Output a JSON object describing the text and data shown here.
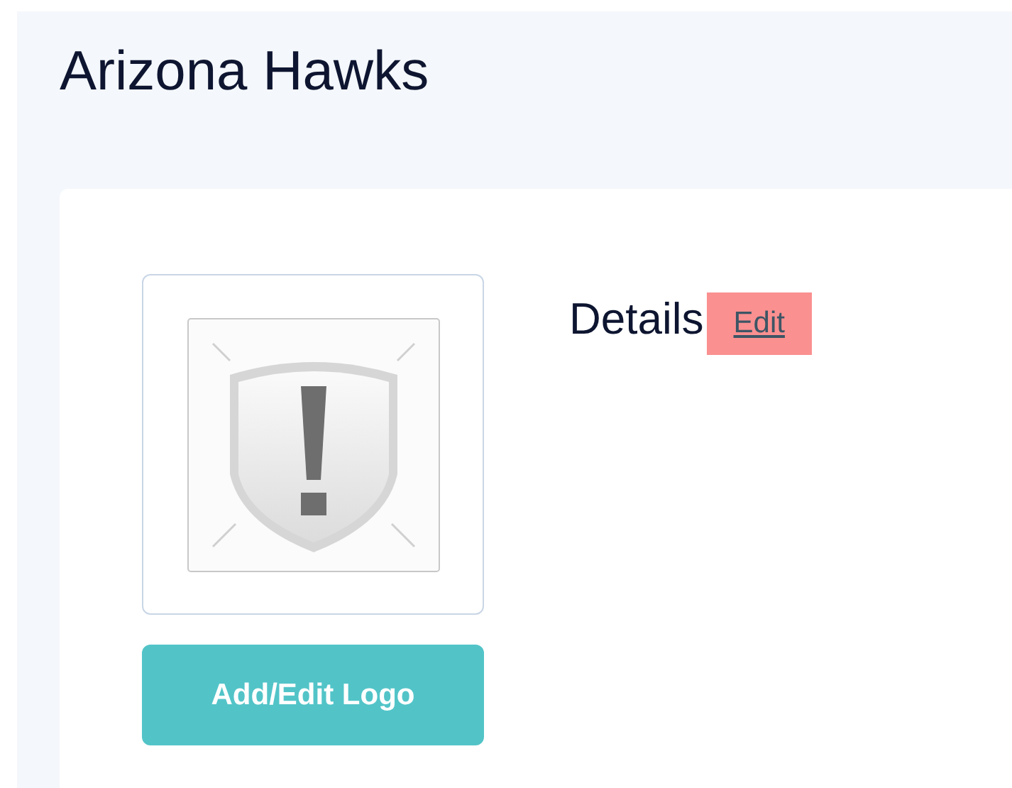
{
  "page_title": "Arizona Hawks",
  "logo": {
    "kind": "picture",
    "button": "Add/Edit Logo"
  },
  "details": {
    "heading": "Details",
    "edit_link": "Edit"
  }
}
